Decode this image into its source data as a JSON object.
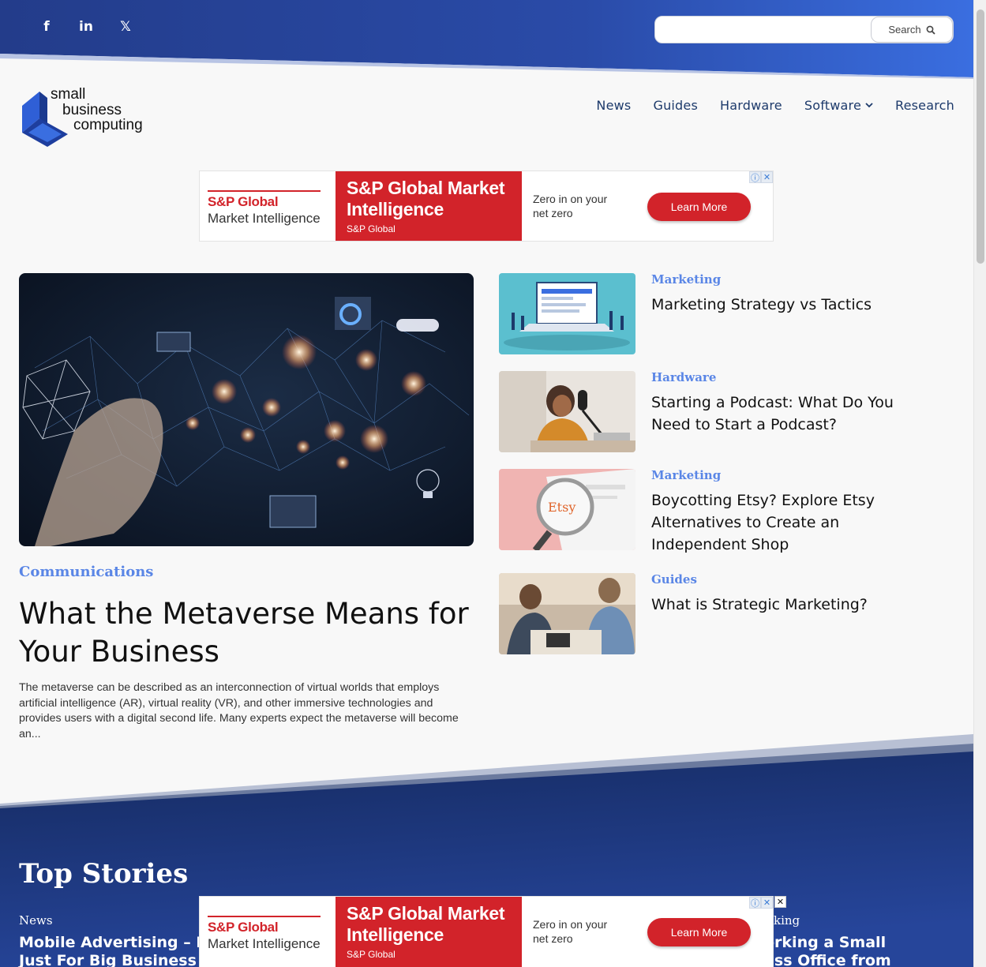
{
  "social": {
    "facebook": "f",
    "linkedin": "in",
    "x": "𝕏"
  },
  "search": {
    "placeholder": "",
    "button_label": "Search"
  },
  "logo": {
    "line1": "small",
    "line2": "business",
    "line3": "computing"
  },
  "nav": {
    "items": [
      {
        "label": "News"
      },
      {
        "label": "Guides"
      },
      {
        "label": "Hardware"
      },
      {
        "label": "Software"
      },
      {
        "label": "Research"
      }
    ]
  },
  "ad": {
    "brand_line1": "S&P Global",
    "brand_line2": "Market Intelligence",
    "headline": "S&P Global Market Intelligence",
    "sponsor": "S&P Global",
    "tagline_line1": "Zero in on your",
    "tagline_line2": "net zero",
    "cta": "Learn More"
  },
  "hero": {
    "category": "Communications",
    "title": "What the Metaverse Means for Your Business",
    "excerpt": "The metaverse can be described as an interconnection of virtual worlds that employs artificial intelligence (AR), virtual reality (VR), and other immersive technologies and provides users with a digital second life. Many experts expect the metaverse will become an..."
  },
  "side": [
    {
      "category": "Marketing",
      "title": "Marketing Strategy vs Tactics"
    },
    {
      "category": "Hardware",
      "title": "Starting a Podcast: What Do You Need to Start a Podcast?"
    },
    {
      "category": "Marketing",
      "title": "Boycotting Etsy? Explore Etsy Alternatives to Create an Independent Shop"
    },
    {
      "category": "Guides",
      "title": "What is Strategic Marketing?"
    }
  ],
  "top_stories": {
    "heading": "Top Stories",
    "items": [
      {
        "category": "News",
        "title_line1": "Mobile Advertising – No",
        "title_line2": "Just For Big Business"
      },
      {
        "category": "king",
        "title_line1": "orking a Small",
        "title_line2": "ess Office from"
      }
    ]
  },
  "colors": {
    "brand_blue": "#1d3a6b",
    "accent": "#5a86e6",
    "ad_red": "#d2232a"
  }
}
